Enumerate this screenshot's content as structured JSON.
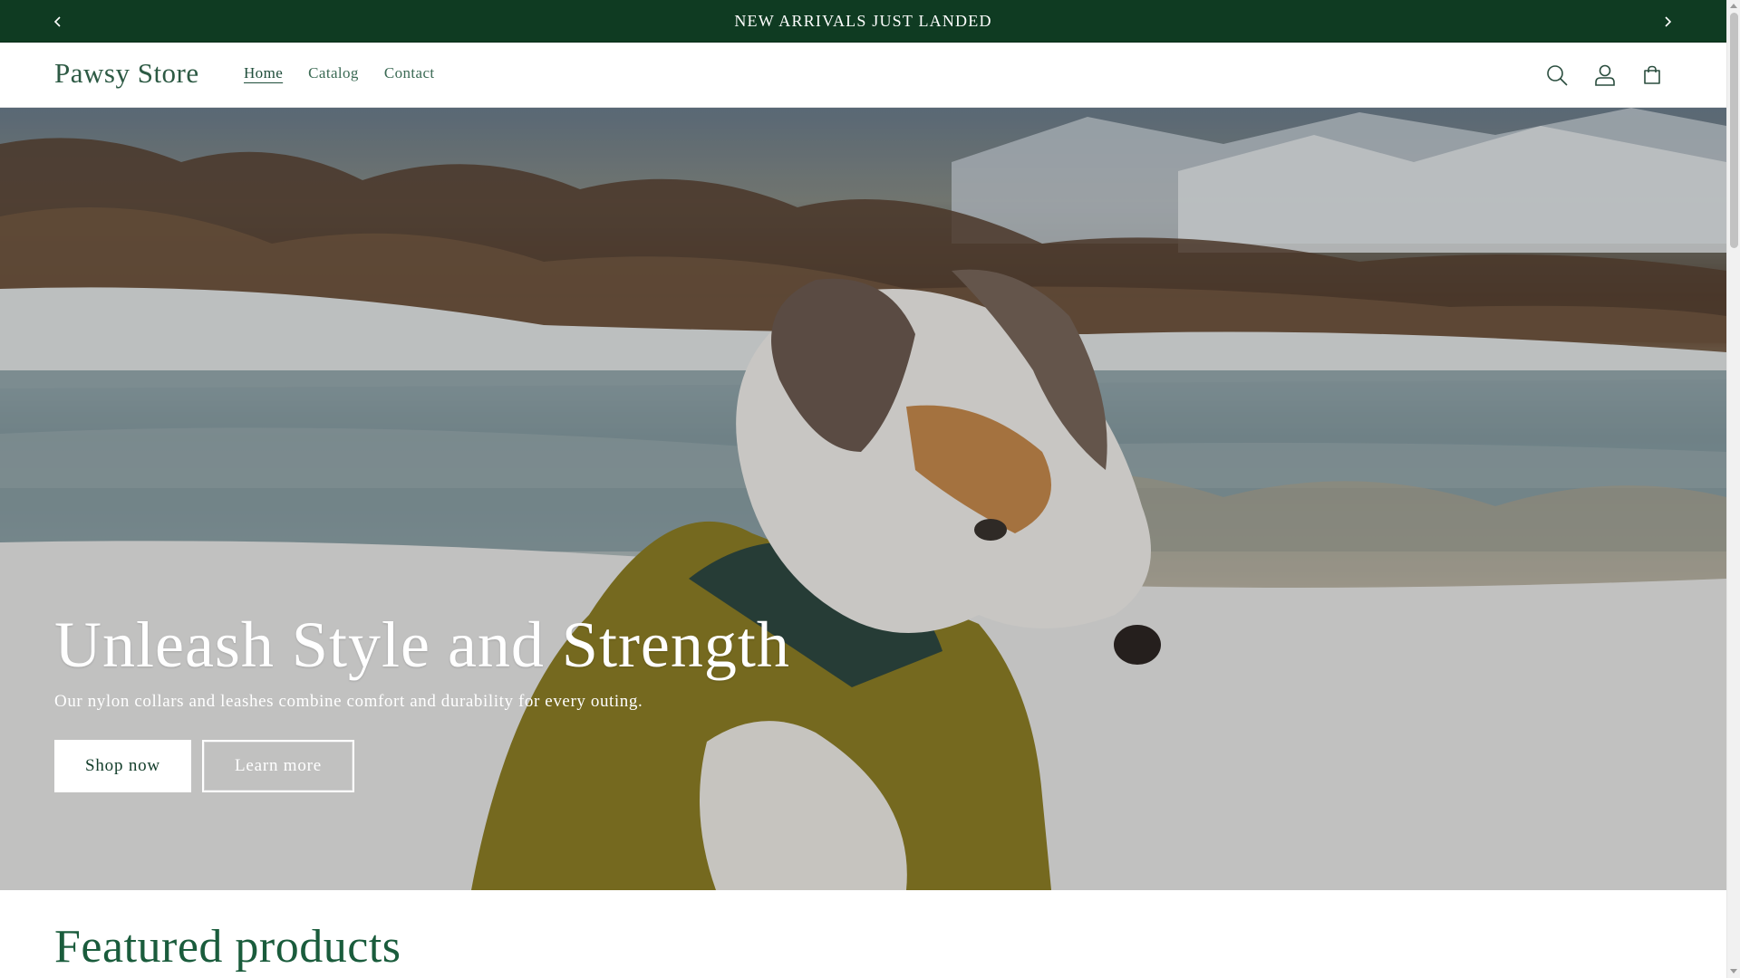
{
  "announcement": {
    "text": "NEW ARRIVALS JUST LANDED",
    "prev_icon": "chevron-left-icon",
    "next_icon": "chevron-right-icon"
  },
  "header": {
    "logo": "Pawsy Store",
    "nav": [
      {
        "label": "Home",
        "active": true
      },
      {
        "label": "Catalog",
        "active": false
      },
      {
        "label": "Contact",
        "active": false
      }
    ],
    "icons": [
      "search-icon",
      "account-icon",
      "cart-icon"
    ]
  },
  "hero": {
    "title": "Unleash Style and Strength",
    "subtitle": "Our nylon collars and leashes combine comfort and durability for every outing.",
    "primary_button": "Shop now",
    "secondary_button": "Learn more",
    "image": "dog-in-yellow-jacket-snow-scene"
  },
  "featured": {
    "title": "Featured products"
  },
  "colors": {
    "announcement_bg": "#0f3b22",
    "brand_text": "#1a5c3c",
    "white": "#ffffff"
  }
}
